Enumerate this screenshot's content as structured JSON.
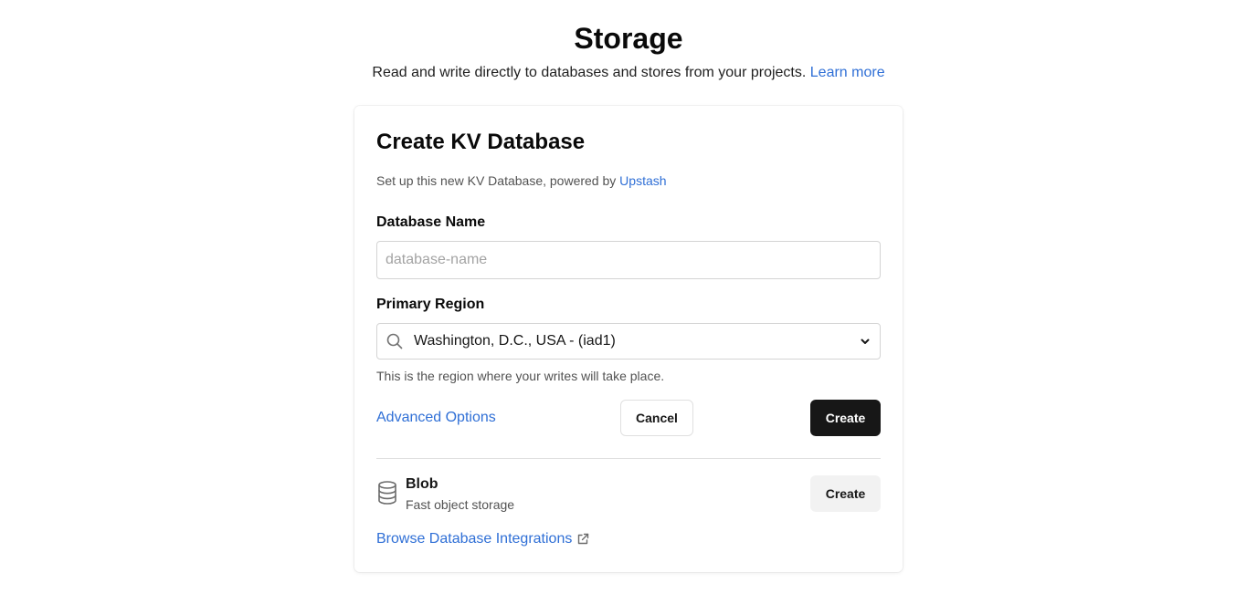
{
  "header": {
    "title": "Storage",
    "subtitle": "Read and write directly to databases and stores from your projects.",
    "learn_more": "Learn more"
  },
  "form": {
    "title": "Create KV Database",
    "description": "Set up this new KV Database, powered by",
    "provider_link": "Upstash",
    "name_label": "Database Name",
    "name_value": "",
    "name_placeholder": "database-name",
    "region_label": "Primary Region",
    "region_value": "Washington, D.C., USA - (iad1)",
    "region_helper": "This is the region where your writes will take place.",
    "advanced_options": "Advanced Options",
    "cancel_label": "Cancel",
    "create_label": "Create"
  },
  "other_stores": {
    "items": [
      {
        "icon": "database-icon",
        "title": "Blob",
        "subtitle": "Fast object storage",
        "action": "Create"
      }
    ],
    "browse_label": "Browse Database Integrations"
  },
  "colors": {
    "link": "#2f6fd6",
    "primary_button": "#171717",
    "secondary_button": "#f2f2f2",
    "border": "#d4d4d4"
  }
}
